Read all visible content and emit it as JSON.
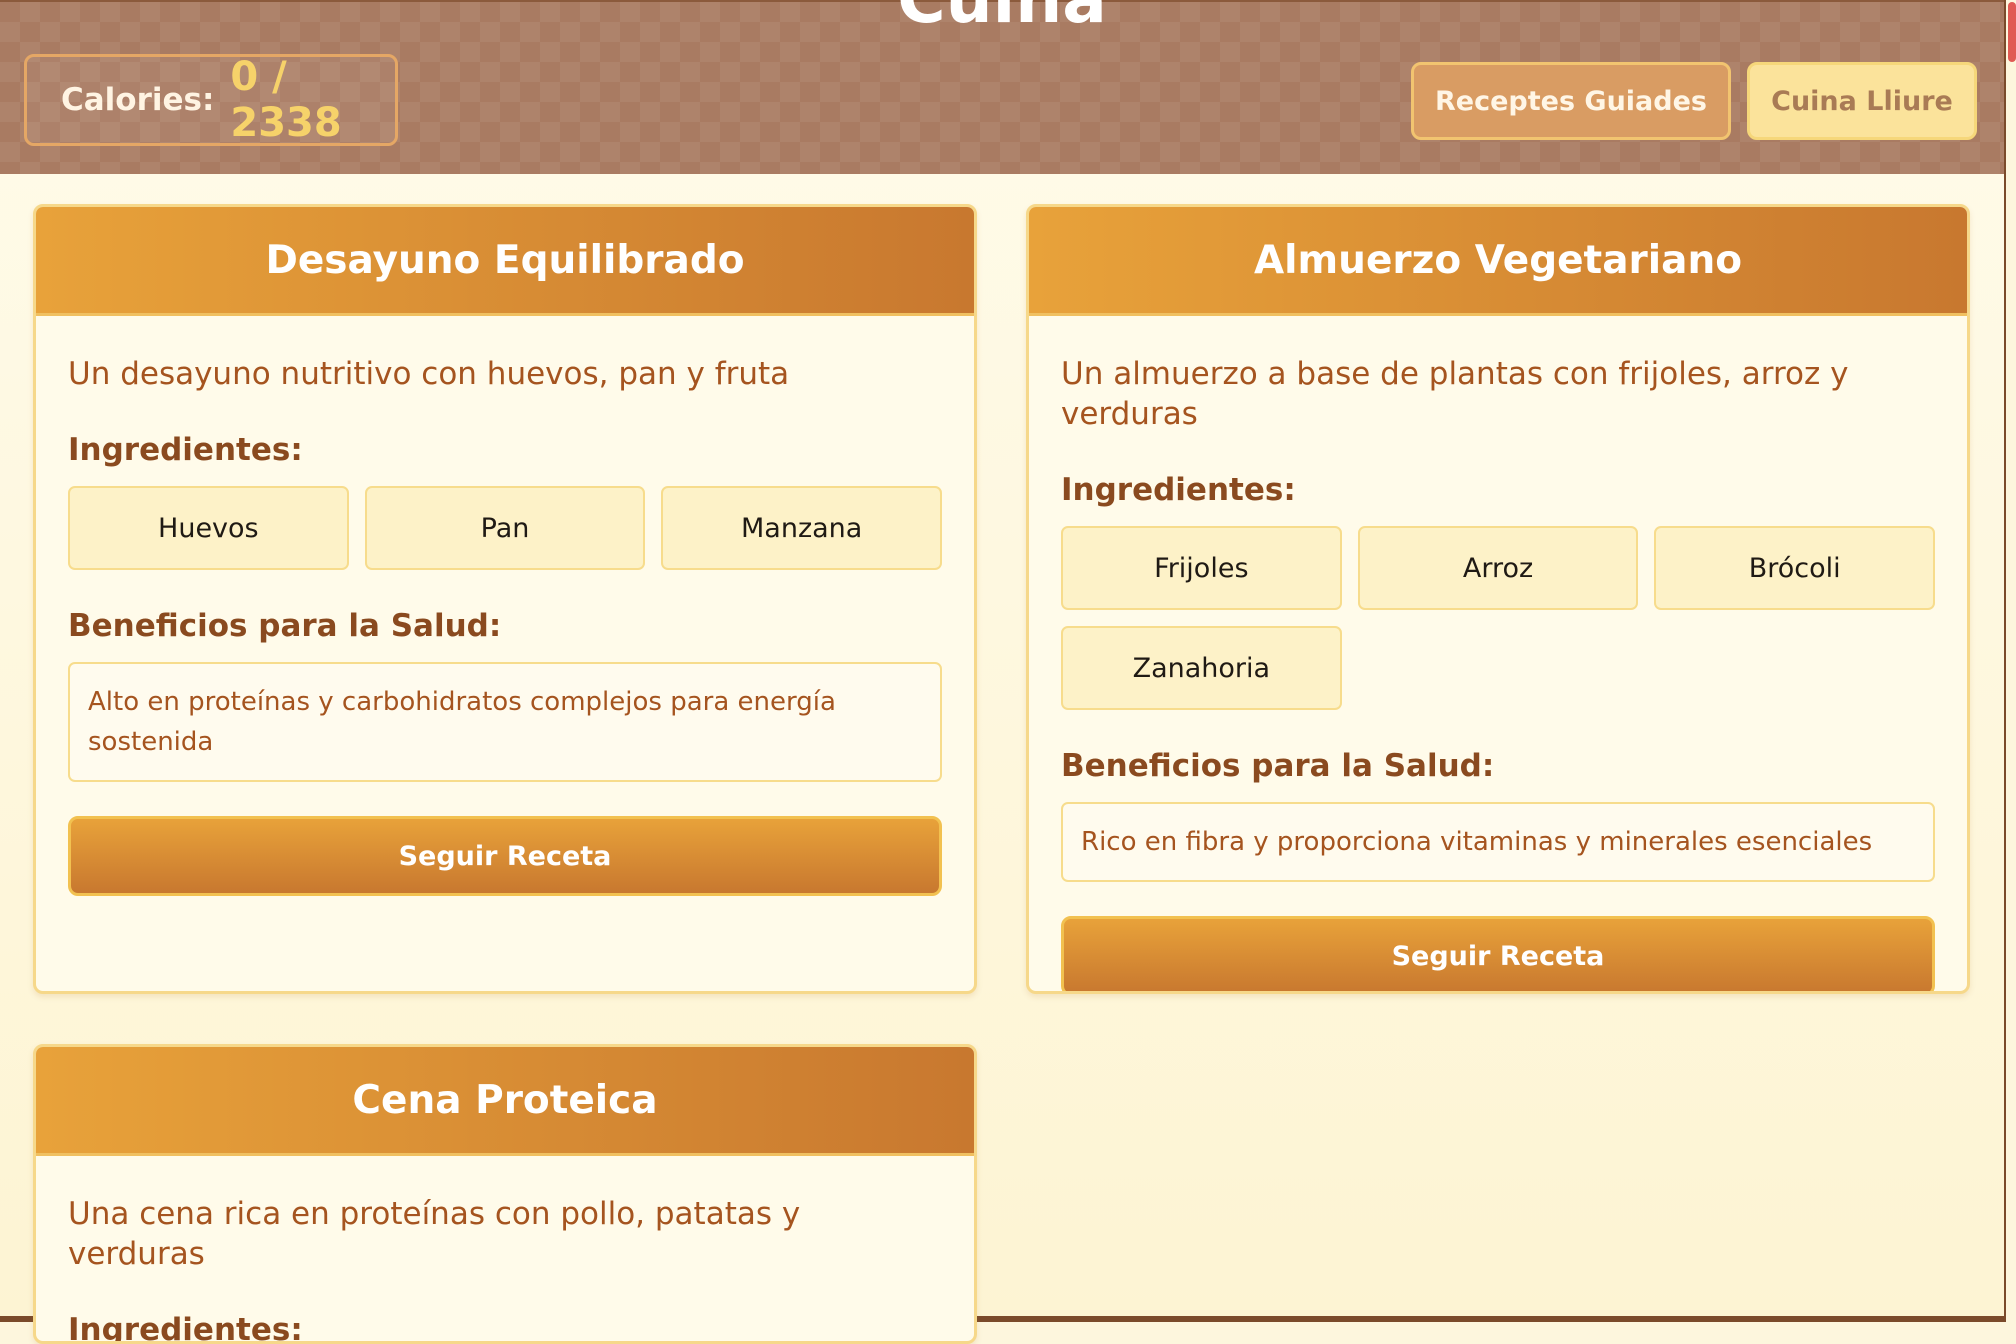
{
  "header": {
    "title": "Cuina",
    "calories_label": "Calories:",
    "calories_value": "0 / 2338",
    "guided_button": "Receptes Guiades",
    "free_button": "Cuina Lliure"
  },
  "recipes": [
    {
      "title": "Desayuno Equilibrado",
      "description": "Un desayuno nutritivo con huevos, pan y fruta",
      "ingredients_label": "Ingredientes:",
      "ingredients": [
        "Huevos",
        "Pan",
        "Manzana"
      ],
      "benefits_label": "Beneficios para la Salud:",
      "benefits": "Alto en proteínas y carbohidratos complejos para energía sostenida",
      "button": "Seguir Receta"
    },
    {
      "title": "Almuerzo Vegetariano",
      "description": "Un almuerzo a base de plantas con frijoles, arroz y verduras",
      "ingredients_label": "Ingredientes:",
      "ingredients": [
        "Frijoles",
        "Arroz",
        "Brócoli",
        "Zanahoria"
      ],
      "benefits_label": "Beneficios para la Salud:",
      "benefits": "Rico en fibra y proporciona vitaminas y minerales esenciales",
      "button": "Seguir Receta"
    },
    {
      "title": "Cena Proteica",
      "description": "Una cena rica en proteínas con pollo, patatas y verduras",
      "ingredients_label": "Ingredientes:"
    }
  ]
}
